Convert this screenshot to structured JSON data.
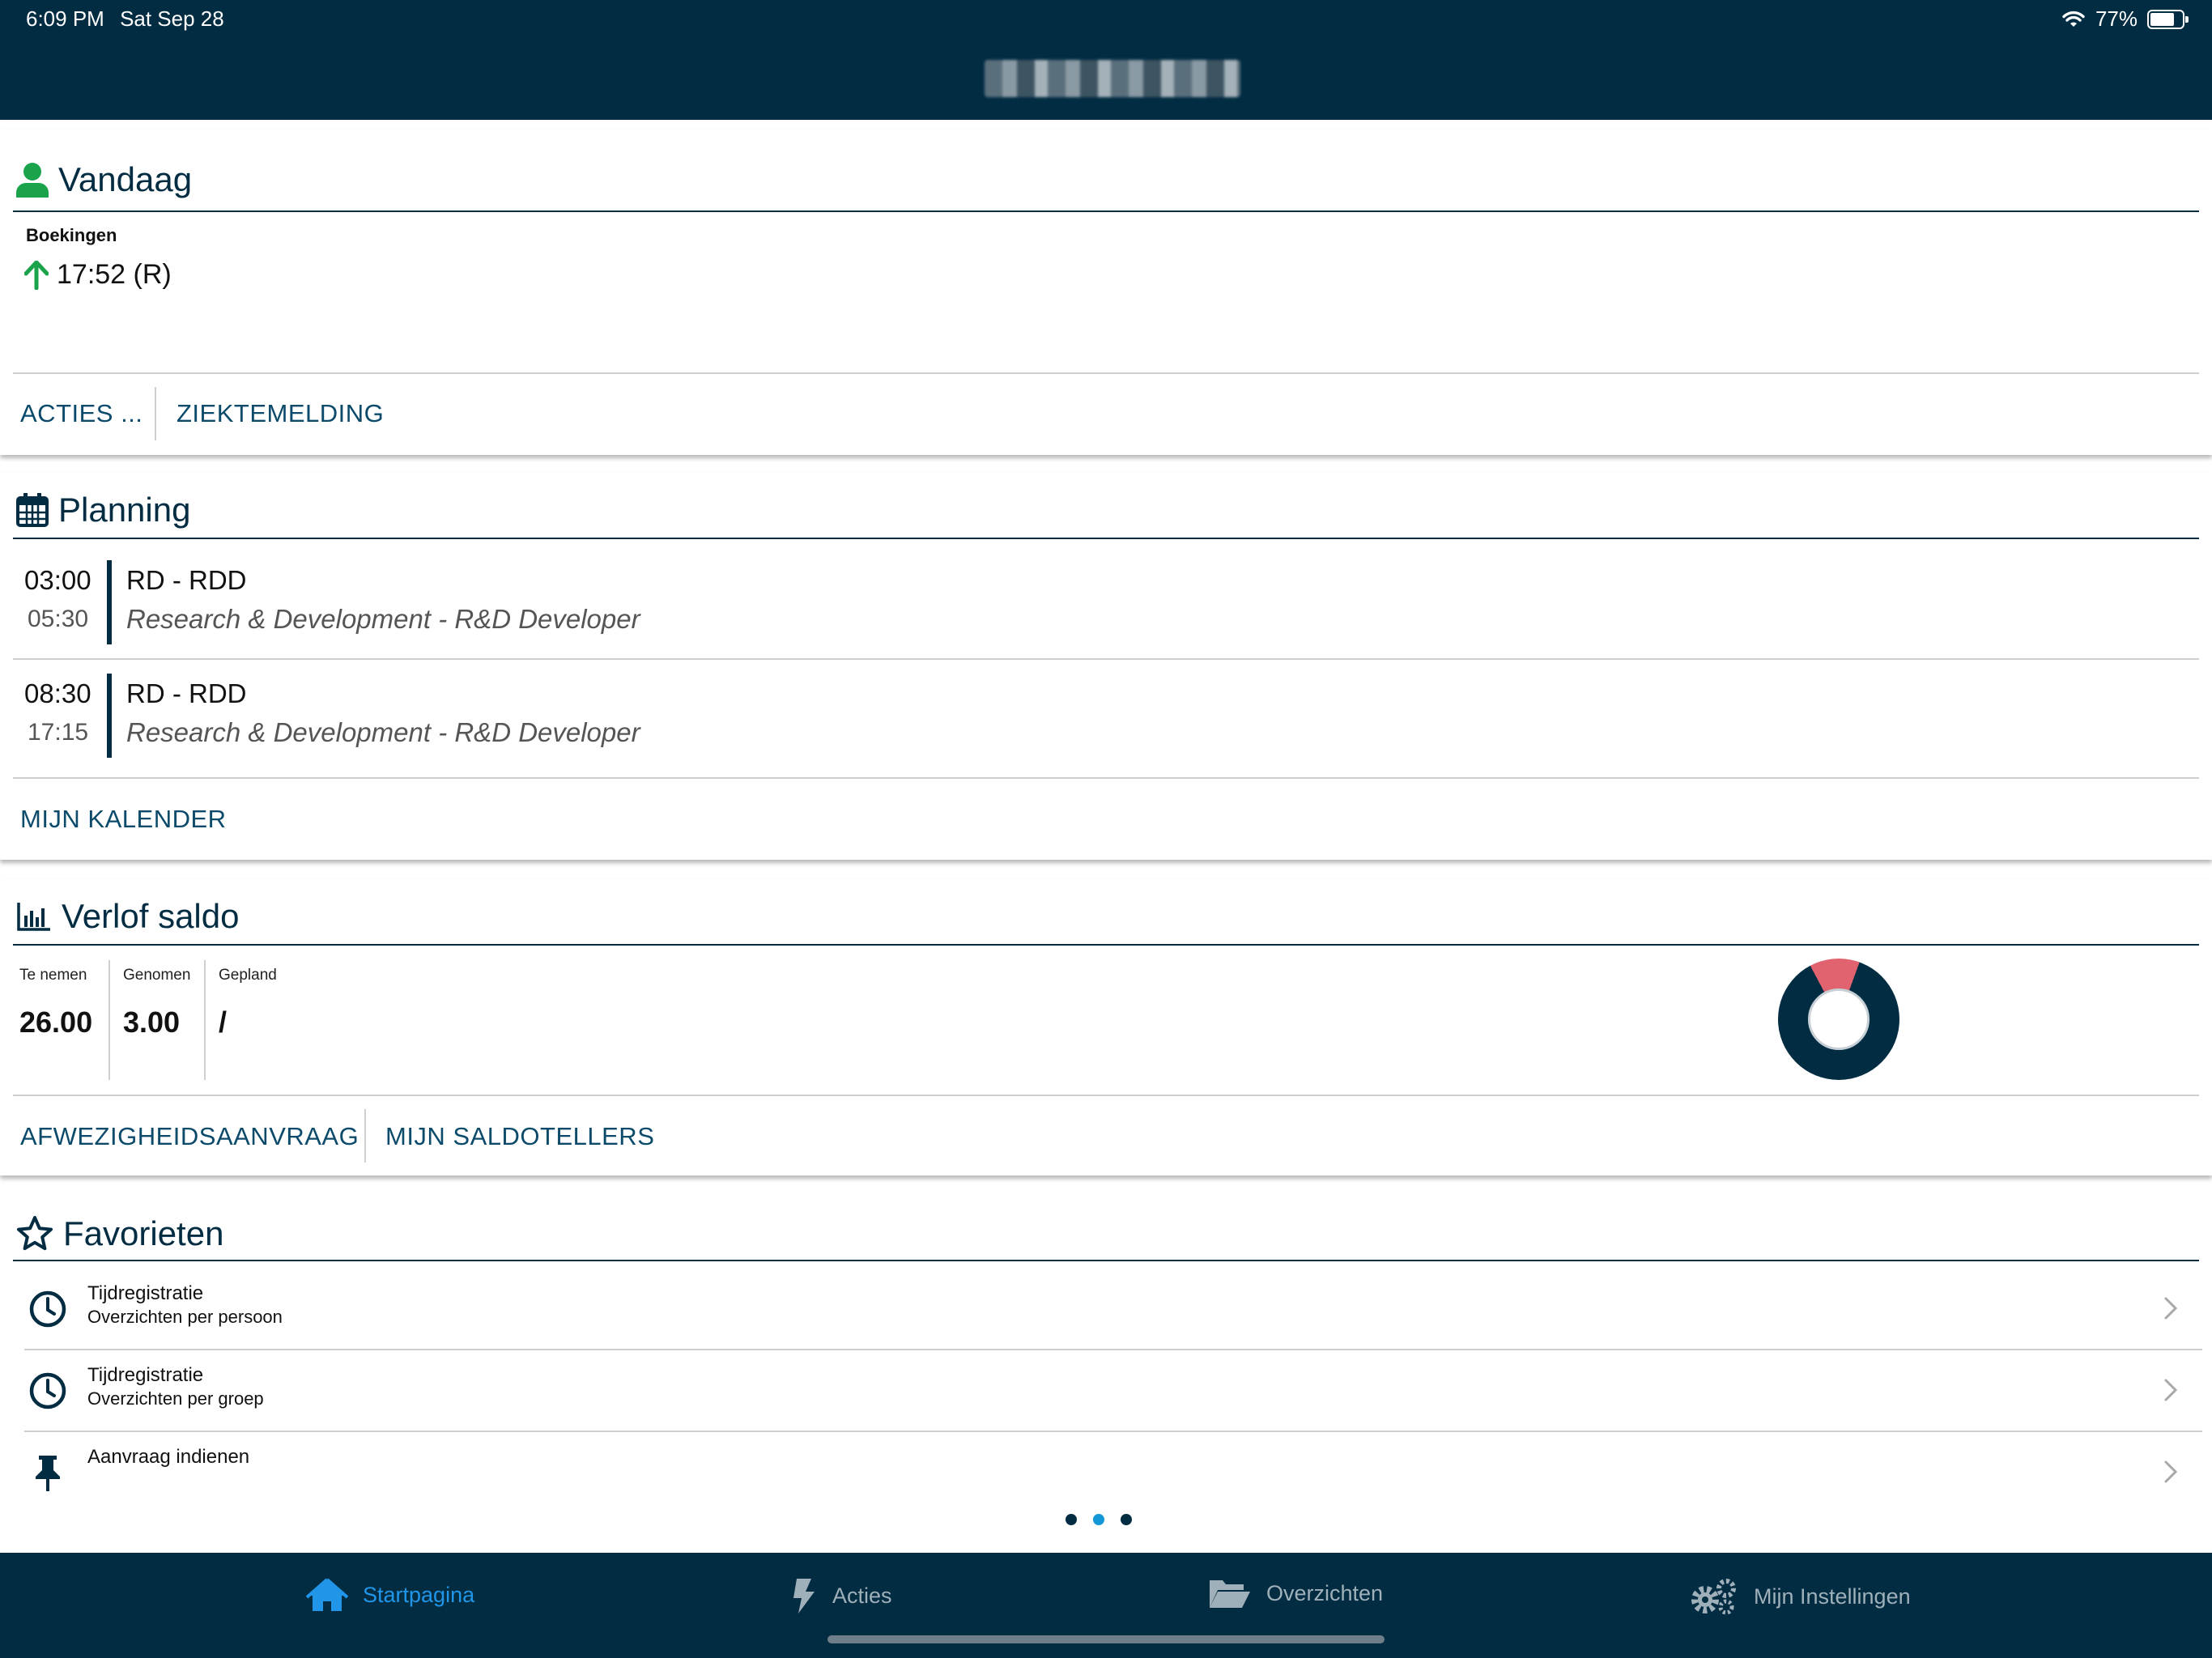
{
  "status_bar": {
    "time": "6:09 PM",
    "date": "Sat Sep 28",
    "battery": "77%"
  },
  "vandaag": {
    "title": "Vandaag",
    "boekingen_label": "Boekingen",
    "boeking": "17:52 (R)",
    "actions": [
      "ACTIES ...",
      "ZIEKTEMELDING"
    ]
  },
  "planning": {
    "title": "Planning",
    "items": [
      {
        "start": "03:00",
        "end": "05:30",
        "code": "RD - RDD",
        "description": "Research & Development - R&D Developer"
      },
      {
        "start": "08:30",
        "end": "17:15",
        "code": "RD - RDD",
        "description": "Research & Development - R&D Developer"
      }
    ],
    "action": "MIJN KALENDER"
  },
  "verlof": {
    "title": "Verlof saldo",
    "stats": [
      {
        "label": "Te nemen",
        "value": "26.00"
      },
      {
        "label": "Genomen",
        "value": "3.00"
      },
      {
        "label": "Gepland",
        "value": "/"
      }
    ],
    "actions": [
      "AFWEZIGHEIDSAANVRAAG",
      "MIJN SALDOTELLERS"
    ],
    "donut_colors": {
      "taken": "#e0636f",
      "remaining": "#012c42"
    }
  },
  "favorieten": {
    "title": "Favorieten",
    "items": [
      {
        "icon": "clock-icon",
        "title": "Tijdregistratie",
        "subtitle": "Overzichten per persoon"
      },
      {
        "icon": "clock-icon",
        "title": "Tijdregistratie",
        "subtitle": "Overzichten per groep"
      },
      {
        "icon": "pin-icon",
        "title": "Aanvraag indienen",
        "subtitle": ""
      }
    ]
  },
  "pager": {
    "pages": 3,
    "active_index": 1
  },
  "tabbar": {
    "tabs": [
      {
        "label": "Startpagina",
        "icon": "home-icon",
        "active": true
      },
      {
        "label": "Acties",
        "icon": "bolt-icon",
        "active": false
      },
      {
        "label": "Overzichten",
        "icon": "folder-icon",
        "active": false
      },
      {
        "label": "Mijn Instellingen",
        "icon": "gear-icon",
        "active": false
      }
    ]
  },
  "colors": {
    "primary": "#012c42",
    "accent": "#1497d6",
    "green": "#1aa34a"
  }
}
